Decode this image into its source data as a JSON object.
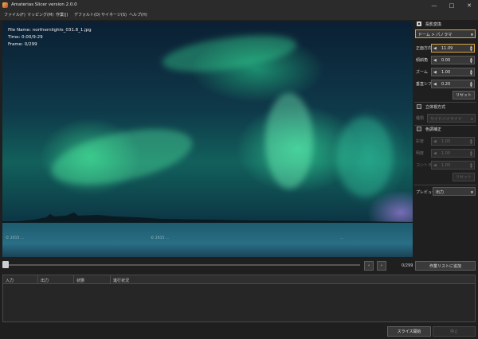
{
  "window": {
    "title": "Amaterias Slicer version 2.0.0",
    "minimize_icon": "minimize-icon",
    "maximize_icon": "maximize-icon",
    "close_icon": "close-icon"
  },
  "menu": [
    {
      "label": "ファイル(F)"
    },
    {
      "label": "マッピング(M)"
    },
    {
      "label": "作業(J)"
    },
    {
      "label": "デフォルト(D)"
    },
    {
      "label": "サイネージ(S)"
    },
    {
      "label": "ヘルプ(H)"
    }
  ],
  "preview": {
    "file_name": "File Name: northernlights_031.8_1.jpg",
    "time": "Time: 0:00/9:29",
    "frame": "Frame: 0/299",
    "watermark_left": "© 2015 ...",
    "watermark_center": "© 2015 ...",
    "watermark_right": "..."
  },
  "projection": {
    "enabled": true,
    "label": "投影変換",
    "mode": "ドーム > パノラマ",
    "fields": [
      {
        "label": "正面方向",
        "value": "11.09"
      },
      {
        "label": "傾斜角",
        "value": "0.00"
      },
      {
        "label": "ズーム",
        "value": "1.00"
      },
      {
        "label": "垂直シフト",
        "value": "0.20"
      }
    ],
    "reset_label": "リセット"
  },
  "stereo": {
    "enabled": false,
    "label": "立体視方式",
    "type_label": "種類",
    "type_value": "サイドバイサイド"
  },
  "color": {
    "enabled": false,
    "label": "色調補正",
    "fields": [
      {
        "label": "彩度",
        "value": "1.00"
      },
      {
        "label": "明度",
        "value": "1.00"
      },
      {
        "label": "コントラスト",
        "value": "1.00"
      }
    ],
    "reset_label": "リセット"
  },
  "preview_select": {
    "label": "プレビュー",
    "value": "出力"
  },
  "timeline": {
    "frame_counter": "0/299",
    "add_button": "作業リストに追加",
    "prev_icon": "chevron-left-icon",
    "next_icon": "chevron-right-icon"
  },
  "job_table": {
    "columns": [
      "入力",
      "出力",
      "状態",
      "進行状況"
    ]
  },
  "footer": {
    "start_button": "スライス開始",
    "stop_button": "停止"
  },
  "colors": {
    "accent": "#d9a441",
    "background": "#1f1f1f"
  }
}
